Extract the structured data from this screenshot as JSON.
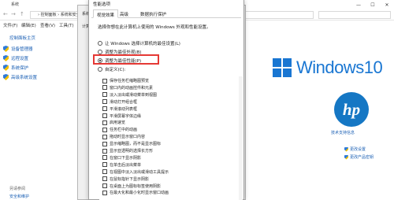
{
  "system_window": {
    "title": "系统",
    "address_path": "› 控制面板 › 系统和安全 › 系统",
    "menu": [
      "文件(F)",
      "编辑(E)",
      "查看(V)",
      "工具(T)"
    ],
    "sidebar_home": "控制面板主页",
    "sidebar_items": [
      "设备管理器",
      "远程设置",
      "系统保护",
      "高级系统设置"
    ],
    "see_also": "另请参阅",
    "security_maintenance": "安全和维护",
    "win10_text": "Windows10",
    "hp_text": "hp",
    "hp_support": "技术支持信息",
    "change_settings": "更改设置",
    "change_product_key": "更改产品密钥"
  },
  "sysprop_dialog": {
    "title": "系统属性",
    "tab": "计算机"
  },
  "perf_dialog": {
    "title": "性能选项",
    "tabs": [
      "视觉效果",
      "高级",
      "数据执行保护"
    ],
    "description": "选择你想在此计算机上使用的 Windows 外观和性能设置。",
    "options": [
      {
        "label": "让 Windows 选择计算机的最佳设置(L)",
        "checked": false
      },
      {
        "label": "调整为最佳外观(B)",
        "checked": false
      },
      {
        "label": "调整为最佳性能(P)",
        "checked": true
      },
      {
        "label": "自定义(C):",
        "checked": false
      }
    ],
    "effects": [
      "保存任务栏缩略图预览",
      "窗口内的动画控件和元素",
      "淡入淡出或滑动菜单到视图",
      "滑动打开组合框",
      "平滑滚动列表框",
      "平滑屏幕字体边缘",
      "启用速览",
      "任务栏中的动画",
      "拖动时显示窗口内容",
      "显示缩略图，而不是显示图标",
      "显示亚透明的选择长方形",
      "在窗口下显示阴影",
      "在单击后淡出菜单",
      "在视图中淡入淡出或滑动工具提示",
      "在鼠标指针下显示阴影",
      "在桌面上为图标标签使用阴影",
      "在最大化和最小化时显示窗口动画"
    ]
  }
}
